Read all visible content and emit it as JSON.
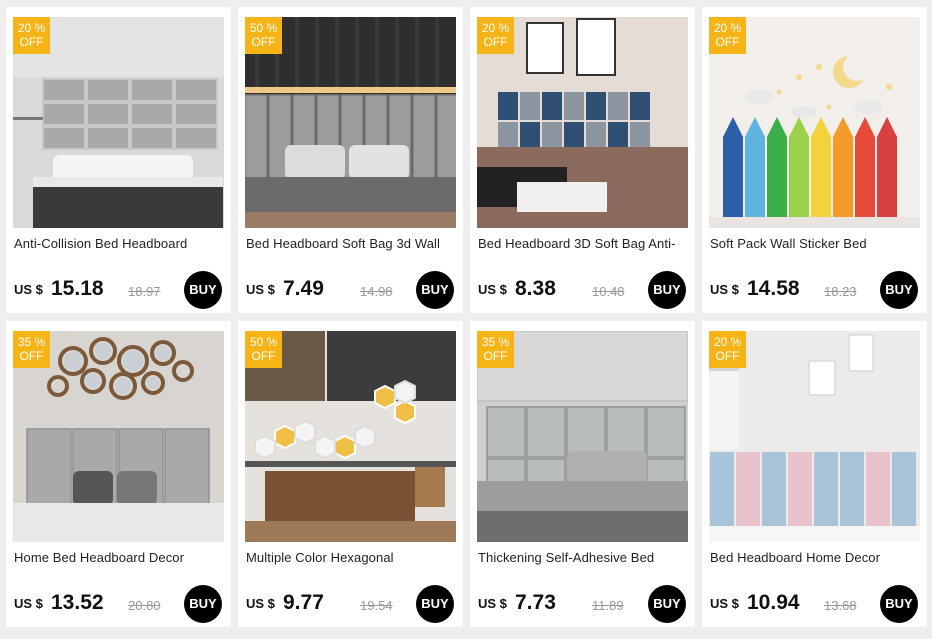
{
  "products": [
    {
      "discount_value": "20 %",
      "discount_label": "OFF",
      "title": "Anti-Collision Bed Headboard",
      "currency": "US $",
      "price": "15.18",
      "old_price": "18.97",
      "buy_label": "BUY"
    },
    {
      "discount_value": "50 %",
      "discount_label": "OFF",
      "title": "Bed Headboard Soft Bag 3d Wall",
      "currency": "US $",
      "price": "7.49",
      "old_price": "14.98",
      "buy_label": "BUY"
    },
    {
      "discount_value": "20 %",
      "discount_label": "OFF",
      "title": "Bed Headboard 3D Soft Bag Anti-",
      "currency": "US $",
      "price": "8.38",
      "old_price": "10.48",
      "buy_label": "BUY"
    },
    {
      "discount_value": "20 %",
      "discount_label": "OFF",
      "title": "Soft Pack Wall Sticker Bed",
      "currency": "US $",
      "price": "14.58",
      "old_price": "18.23",
      "buy_label": "BUY"
    },
    {
      "discount_value": "35 %",
      "discount_label": "OFF",
      "title": "Home Bed Headboard Decor",
      "currency": "US $",
      "price": "13.52",
      "old_price": "20.80",
      "buy_label": "BUY"
    },
    {
      "discount_value": "50 %",
      "discount_label": "OFF",
      "title": "Multiple Color Hexagonal",
      "currency": "US $",
      "price": "9.77",
      "old_price": "19.54",
      "buy_label": "BUY"
    },
    {
      "discount_value": "35 %",
      "discount_label": "OFF",
      "title": "Thickening Self-Adhesive Bed",
      "currency": "US $",
      "price": "7.73",
      "old_price": "11.89",
      "buy_label": "BUY"
    },
    {
      "discount_value": "20 %",
      "discount_label": "OFF",
      "title": "Bed Headboard Home Decor",
      "currency": "US $",
      "price": "10.94",
      "old_price": "13.68",
      "buy_label": "BUY"
    }
  ],
  "colors": {
    "badge": "#f6b417",
    "buy_button": "#000000",
    "old_price": "#999999"
  }
}
